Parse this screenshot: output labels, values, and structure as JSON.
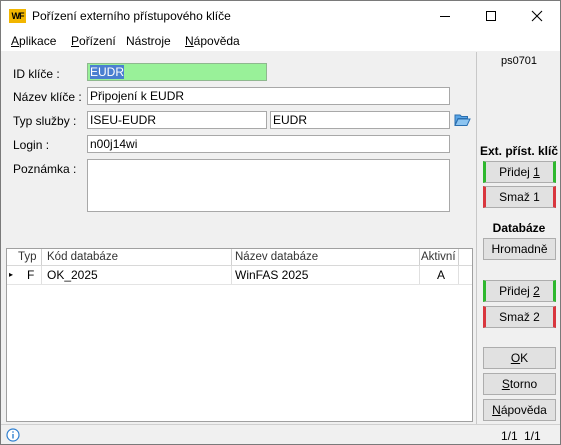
{
  "window": {
    "title": "Pořízení externího přístupového klíče",
    "app_icon_text": "WF"
  },
  "menu": [
    {
      "label": "Aplikace",
      "u_index": 0
    },
    {
      "label": "Pořízení",
      "u_index": 0
    },
    {
      "label": "Nástroje",
      "u_index": 6
    },
    {
      "label": "Nápověda",
      "u_index": 0
    }
  ],
  "form": {
    "code": "ps0701",
    "id_label": "ID klíče :",
    "id_value": "EUDR",
    "name_label": "Název klíče :",
    "name_value": "Připojení k EUDR",
    "service_label": "Typ služby :",
    "service_code": "ISEU-EUDR",
    "service_name": "EUDR",
    "login_label": "Login :",
    "login_value": "n00j14wi",
    "note_label": "Poznámka :",
    "note_value": ""
  },
  "grid": {
    "columns": [
      "Typ",
      "Kód databáze",
      "Název databáze",
      "Aktivní"
    ],
    "rows": [
      {
        "typ": "F",
        "kod": "OK_2025",
        "nazev": "WinFAS 2025",
        "aktivni": "A"
      }
    ],
    "row_marker": "▸"
  },
  "side": {
    "ext_title": "Ext. příst. klíč",
    "ext_add": {
      "pre": "Přidej ",
      "u": "1",
      "post": ""
    },
    "ext_del": "Smaž 1",
    "db_title": "Databáze",
    "db_bulk": "Hromadně",
    "db_add": {
      "pre": "Přidej ",
      "u": "2",
      "post": ""
    },
    "db_del": "Smaž 2",
    "ok": {
      "pre": "",
      "u": "O",
      "post": "K"
    },
    "storno": {
      "pre": "",
      "u": "S",
      "post": "torno"
    },
    "help": {
      "pre": "",
      "u": "N",
      "post": "ápověda"
    }
  },
  "status": {
    "left": "1/1",
    "right": "1/1"
  },
  "colors": {
    "id_highlight": "#99f199",
    "add_accent": "#2eb82e",
    "delete_accent": "#d9363e",
    "folder_icon": "#3a8fd6"
  },
  "icons": {
    "app": "wf-logo-icon",
    "open": "folder-open-icon",
    "info": "info-icon"
  }
}
